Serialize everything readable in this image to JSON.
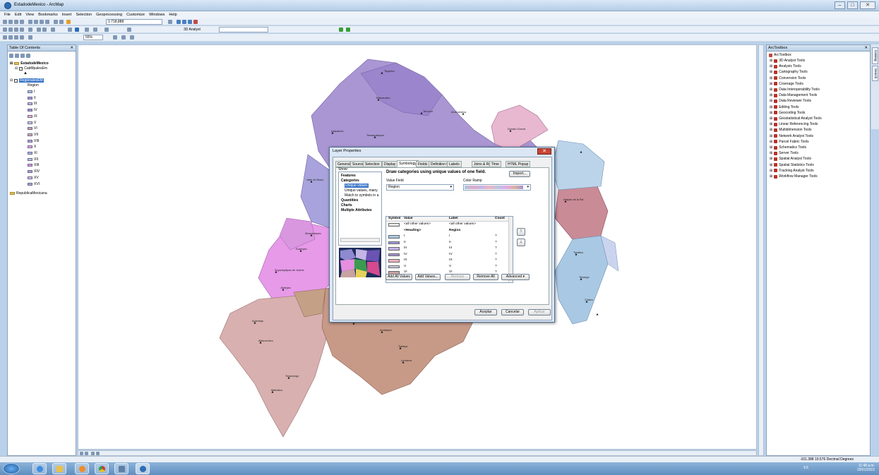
{
  "window": {
    "title": "EstadodeMexico - ArcMap"
  },
  "menu": [
    "File",
    "Edit",
    "View",
    "Bookmarks",
    "Insert",
    "Selection",
    "Geoprocessing",
    "Customize",
    "Windows",
    "Help"
  ],
  "toolbar": {
    "scale": "1:718,888",
    "analyst": "3D Analyst",
    "zoom": "55%"
  },
  "toc": {
    "header": "Table Of Contents",
    "root": "EstadodeMexico",
    "layer1": "CabMpalesEm",
    "layer2": "RegionalesEM",
    "field": "Region",
    "classes": [
      {
        "label": "I",
        "color": "#a9c9e2"
      },
      {
        "label": "II",
        "color": "#9f9be0"
      },
      {
        "label": "III",
        "color": "#c4b5e6"
      },
      {
        "label": "IV",
        "color": "#a68fd4"
      },
      {
        "label": "IX",
        "color": "#f0b3c0"
      },
      {
        "label": "V",
        "color": "#c8cde4"
      },
      {
        "label": "VI",
        "color": "#c8a2a0"
      },
      {
        "label": "VII",
        "color": "#d7b39b"
      },
      {
        "label": "VIII",
        "color": "#c19be0"
      },
      {
        "label": "X",
        "color": "#e6a5e8"
      },
      {
        "label": "XI",
        "color": "#a9b2e8"
      },
      {
        "label": "XII",
        "color": "#b7c4e3"
      },
      {
        "label": "XIII",
        "color": "#e48fe0"
      },
      {
        "label": "XIV",
        "color": "#b59ad6"
      },
      {
        "label": "XV",
        "color": "#d7b9e2"
      },
      {
        "label": "XVI",
        "color": "#a6a6da"
      }
    ],
    "other": "RepublicaMexicana"
  },
  "map": {
    "labels": [
      {
        "t": "Tejupilco",
        "c": "text"
      },
      {
        "t": "Tlalmanalco",
        "c": "text"
      },
      {
        "t": "Texcoco",
        "c": "text"
      },
      {
        "t": "Amecameca",
        "c": "text"
      },
      {
        "t": "Ixtapaluca",
        "c": "text"
      },
      {
        "t": "Temascaltepec",
        "c": "text"
      },
      {
        "t": "Valle de Bravo",
        "c": "text"
      },
      {
        "t": "Donato Guerra",
        "c": "text"
      },
      {
        "t": "Zinacantepec",
        "c": "text"
      },
      {
        "t": "Ecatepec",
        "c": "text"
      },
      {
        "t": "Soyaniquilpan de Juárez",
        "c": "text"
      },
      {
        "t": "Jilotepec",
        "c": "text"
      },
      {
        "t": "Acambay",
        "c": "text"
      },
      {
        "t": "Atlacomulco",
        "c": "text"
      },
      {
        "t": "Tenancingo",
        "c": "text"
      },
      {
        "t": "Malinalco",
        "c": "text"
      },
      {
        "t": "Tejupilco",
        "c": "text"
      },
      {
        "t": "Amatepec",
        "c": "text"
      },
      {
        "t": "Tlatlaya",
        "c": "text"
      },
      {
        "t": "Luvianos",
        "c": "text"
      },
      {
        "t": "Ixtapan de la Sal",
        "c": "text"
      },
      {
        "t": "Tonatico",
        "c": "text"
      },
      {
        "t": "Tenango",
        "c": "text"
      },
      {
        "t": "Chalco",
        "c": "text"
      }
    ]
  },
  "dialog": {
    "title": "Layer Properties",
    "tabs": [
      "General",
      "Source",
      "Selection",
      "Display",
      "Symbology",
      "Fields",
      "Definition Query",
      "Labels",
      "Joins & Relates",
      "Time",
      "HTML Popup"
    ],
    "active_tab": "Symbology",
    "show_label": "Show:",
    "show_items": [
      "Features",
      "Categories",
      "Unique values",
      "Unique values, many",
      "Match to symbols in a",
      "Quantities",
      "Charts",
      "Multiple Attributes"
    ],
    "heading": "Draw categories using unique values of one field.",
    "import": "Import...",
    "value_field_label": "Value Field",
    "value_field": "Region",
    "color_ramp_label": "Color Ramp",
    "col_symbol": "Symbol",
    "col_value": "Value",
    "col_label": "Label",
    "col_count": "Count",
    "rows": [
      {
        "value": "<all other values>",
        "label": "<all other values>",
        "count": "",
        "color": "#e6e6e6"
      },
      {
        "value": "<Heading>",
        "label": "Region",
        "count": "",
        "color": ""
      },
      {
        "value": "I",
        "label": "I",
        "count": "?",
        "color": "#a9c9e2"
      },
      {
        "value": "II",
        "label": "II",
        "count": "?",
        "color": "#9f9be0"
      },
      {
        "value": "III",
        "label": "III",
        "count": "?",
        "color": "#c4b5e6"
      },
      {
        "value": "IV",
        "label": "IV",
        "count": "?",
        "color": "#a68fd4"
      },
      {
        "value": "IX",
        "label": "IX",
        "count": "?",
        "color": "#f0b3c0"
      },
      {
        "value": "V",
        "label": "V",
        "count": "?",
        "color": "#c8cde4"
      },
      {
        "value": "VI",
        "label": "VI",
        "count": "?",
        "color": "#c8a2a0"
      },
      {
        "value": "VII",
        "label": "VII",
        "count": "?",
        "color": "#d7b39b"
      }
    ],
    "buttons": {
      "add_all": "Add All Values",
      "add": "Add Values...",
      "remove": "Remove",
      "remove_all": "Remove All",
      "advanced": "Advanced"
    },
    "footer": {
      "ok": "Aceptar",
      "cancel": "Cancelar",
      "apply": "Aplicar"
    }
  },
  "arctoolbox": {
    "header": "ArcToolbox",
    "root": "ArcToolbox",
    "tools": [
      "3D Analyst Tools",
      "Analysis Tools",
      "Cartography Tools",
      "Conversion Tools",
      "Coverage Tools",
      "Data Interoperability Tools",
      "Data Management Tools",
      "Data Reviewer Tools",
      "Editing Tools",
      "Geocoding Tools",
      "Geostatistical Analyst Tools",
      "Linear Referencing Tools",
      "Multidimension Tools",
      "Network Analyst Tools",
      "Parcel Fabric Tools",
      "Schematics Tools",
      "Server Tools",
      "Spatial Analyst Tools",
      "Spatial Statistics Tools",
      "Tracking Analyst Tools",
      "Workflow Manager Tools"
    ],
    "side_tabs": [
      "Catalog",
      "Search"
    ]
  },
  "status": {
    "coords": "-101.388  19.576 Decimal Degrees"
  },
  "taskbar": {
    "lang": "ES",
    "time": "11:48 a.m.",
    "date": "29/01/2015"
  }
}
